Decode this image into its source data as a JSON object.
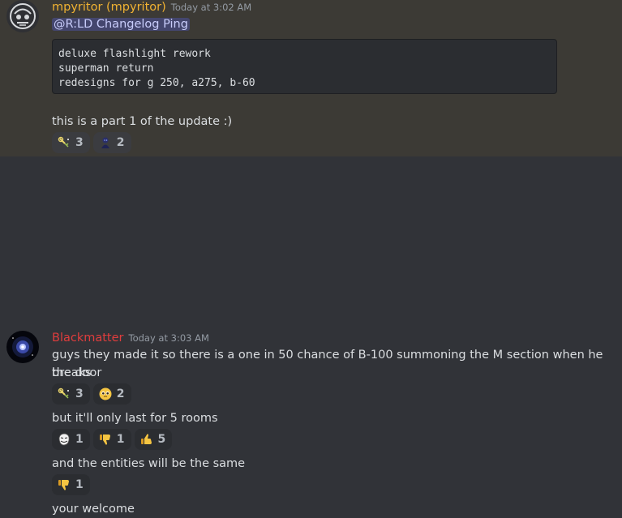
{
  "messages": [
    {
      "author": "mpyritor (mpyritor)",
      "author_color": "#f0b232",
      "timestamp": "Today at 3:02 AM",
      "mention": "@R:LD Changelog Ping",
      "code_lines": [
        "deluxe flashlight rework",
        "superman return",
        "redesigns for g 250, a275, b-60"
      ],
      "text": "this is a part 1 of the update :)",
      "reactions": [
        {
          "emoji": "sparkle-key-emoji",
          "count": "3"
        },
        {
          "emoji": "dark-figure-emoji",
          "count": "2"
        }
      ]
    },
    {
      "author": "Blackmatter",
      "author_color": "#e03d3d",
      "timestamp": "Today at 3:03 AM",
      "lines": [
        {
          "text_1": "guys they made it so there is a one in 50 chance of B-100 summoning the M section when he breaks",
          "text_2": "the door",
          "reactions": [
            {
              "emoji": "sparkle-key-emoji",
              "count": "3"
            },
            {
              "emoji": "pleading-face-emoji",
              "count": "2"
            }
          ]
        },
        {
          "text": "but it'll only last for 5 rooms",
          "reactions": [
            {
              "emoji": "troll-face-emoji",
              "count": "1"
            },
            {
              "emoji": "thumbs-down-emoji",
              "count": "1"
            },
            {
              "emoji": "thumbs-up-emoji",
              "count": "5"
            }
          ]
        },
        {
          "text": "and the entities will be the same",
          "reactions": [
            {
              "emoji": "thumbs-down-emoji",
              "count": "1"
            }
          ]
        },
        {
          "text": "your welcome"
        }
      ]
    }
  ]
}
